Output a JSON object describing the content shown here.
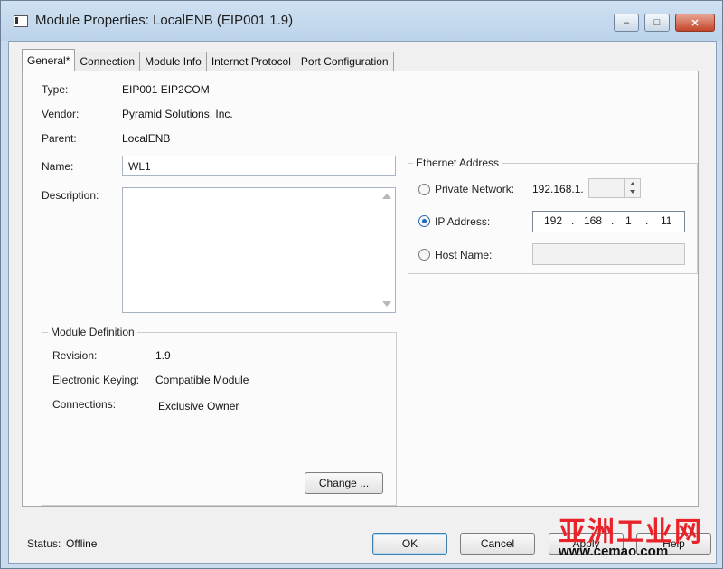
{
  "window": {
    "title": "Module Properties: LocalENB (EIP001 1.9)"
  },
  "caption": {
    "minimize": "–",
    "maximize": "□",
    "close": "✕"
  },
  "tabs": [
    {
      "label": "General*"
    },
    {
      "label": "Connection"
    },
    {
      "label": "Module Info"
    },
    {
      "label": "Internet Protocol"
    },
    {
      "label": "Port Configuration"
    }
  ],
  "general": {
    "type_label": "Type:",
    "type_value": "EIP001 EIP2COM",
    "vendor_label": "Vendor:",
    "vendor_value": "Pyramid Solutions, Inc.",
    "parent_label": "Parent:",
    "parent_value": "LocalENB",
    "name_label": "Name:",
    "name_value": "WL1",
    "description_label": "Description:",
    "description_value": ""
  },
  "module_definition": {
    "title": "Module Definition",
    "revision_label": "Revision:",
    "revision_value": "1.9",
    "keying_label": "Electronic Keying:",
    "keying_value": "Compatible Module",
    "connections_label": "Connections:",
    "connections_value": "Exclusive Owner",
    "change_button": "Change ..."
  },
  "ethernet": {
    "title": "Ethernet Address",
    "private_label": "Private Network:",
    "private_prefix": "192.168.1.",
    "private_value": "",
    "ip_label": "IP Address:",
    "ip_octets": [
      "192",
      "168",
      "1",
      "11"
    ],
    "ip_dot": ".",
    "host_label": "Host Name:",
    "host_value": "",
    "selected": "ip"
  },
  "footer": {
    "status_label": "Status:",
    "status_value": "Offline",
    "ok": "OK",
    "cancel": "Cancel",
    "apply": "Apply",
    "help": "Help"
  },
  "watermark": {
    "brand": "亚洲工业网",
    "url": "www.cemao.com"
  },
  "colors": {
    "accent": "#1e67c3",
    "watermark_red": "#e8232a"
  }
}
